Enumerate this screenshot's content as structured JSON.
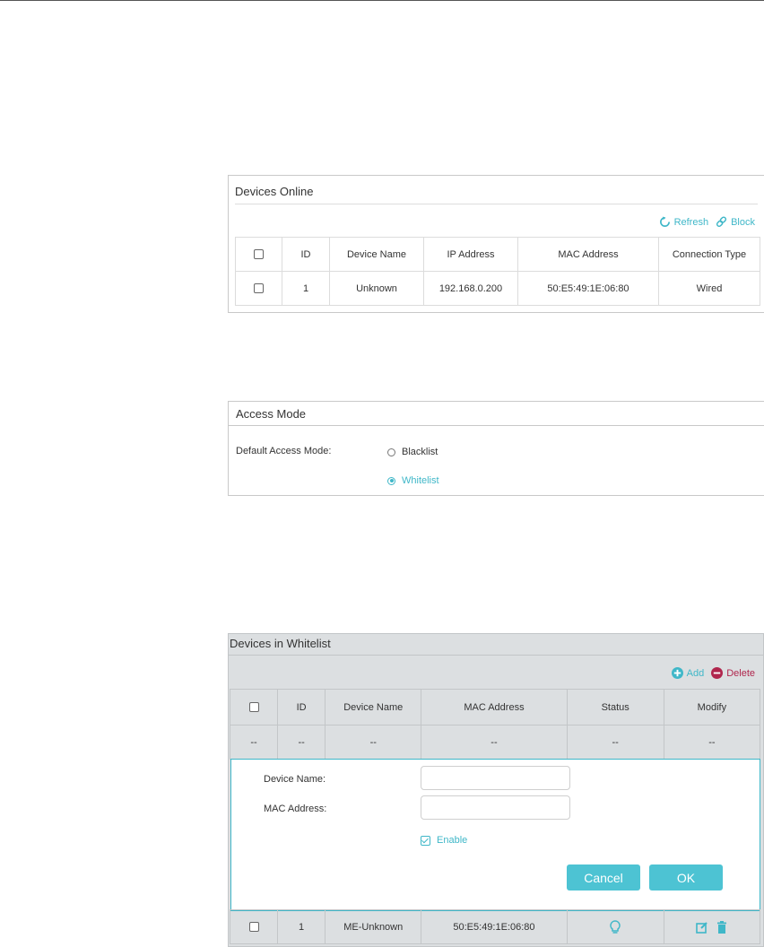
{
  "devices_online": {
    "title": "Devices Online",
    "refresh_label": "Refresh",
    "block_label": "Block",
    "columns": [
      "ID",
      "Device Name",
      "IP Address",
      "MAC Address",
      "Connection Type"
    ],
    "rows": [
      {
        "id": "1",
        "name": "Unknown",
        "ip": "192.168.0.200",
        "mac": "50:E5:49:1E:06:80",
        "type": "Wired"
      }
    ]
  },
  "access_mode": {
    "title": "Access Mode",
    "label": "Default Access Mode:",
    "options": [
      "Blacklist",
      "Whitelist"
    ],
    "selected": "Whitelist"
  },
  "whitelist": {
    "title": "Devices in Whitelist",
    "add_label": "Add",
    "delete_label": "Delete",
    "columns": [
      "ID",
      "Device Name",
      "MAC Address",
      "Status",
      "Modify"
    ],
    "placeholder_row": [
      "--",
      "--",
      "--",
      "--",
      "--",
      "--"
    ],
    "editor": {
      "device_name_label": "Device Name:",
      "device_name_value": "",
      "mac_label": "MAC Address:",
      "mac_value": "",
      "enable_label": "Enable",
      "enable_checked": true,
      "cancel_label": "Cancel",
      "ok_label": "OK"
    },
    "rows": [
      {
        "id": "1",
        "name": "ME-Unknown",
        "mac": "50:E5:49:1E:06:80",
        "status_icon": "bulb-icon"
      }
    ]
  },
  "colors": {
    "accent": "#3fb7c8",
    "delete": "#b0264d",
    "button": "#4dc3d3"
  }
}
